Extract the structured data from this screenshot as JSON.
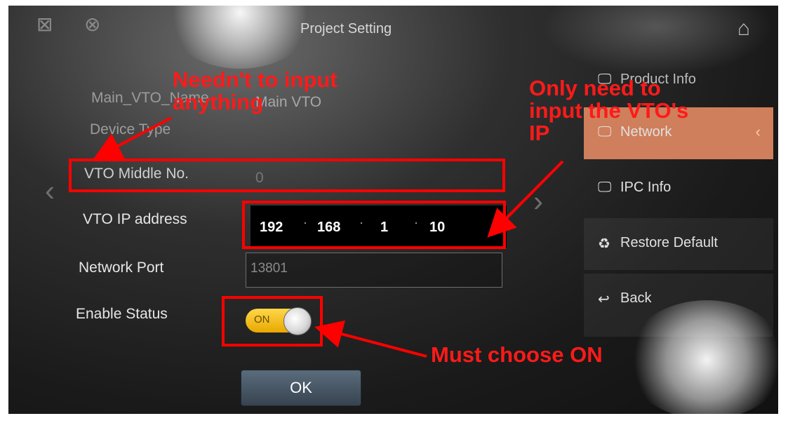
{
  "header": {
    "title": "Project Setting",
    "left_icons": [
      "network-disconnected-icon",
      "user-disconnected-icon"
    ],
    "home_icon": "home-icon"
  },
  "form": {
    "vto_name": {
      "label": "Main_VTO_Name",
      "value": "Main VTO"
    },
    "device_type": {
      "label": "Device Type"
    },
    "vto_middle_no": {
      "label": "VTO Middle No.",
      "value": "0"
    },
    "vto_ip": {
      "label": "VTO IP address",
      "seg1": "192",
      "seg2": "168",
      "seg3": "1",
      "seg4": "10",
      "dot": "·"
    },
    "network_port": {
      "label": "Network Port",
      "value": "13801"
    },
    "enable_status": {
      "label": "Enable Status",
      "toggle_text": "ON"
    },
    "ok_label": "OK"
  },
  "sidebar": {
    "items": [
      {
        "label": "Product Info",
        "icon": "monitor-icon"
      },
      {
        "label": "Network",
        "icon": "monitor-icon",
        "selected": true
      },
      {
        "label": "IPC Info",
        "icon": "monitor-icon"
      },
      {
        "label": "Restore Default",
        "icon": "recycle-icon"
      },
      {
        "label": "Back",
        "icon": "back-arrow-icon"
      }
    ]
  },
  "annotations": {
    "no_input_line1": "Needn't to input",
    "no_input_line2": "anything",
    "ip_line1": "Only need to",
    "ip_line2": "input the VTO's",
    "ip_line3": "IP",
    "must_on": "Must choose ON"
  },
  "colors": {
    "annotation": "#ff0000",
    "selected_tab": "#cf7f5b",
    "toggle": "#ffcc33"
  }
}
